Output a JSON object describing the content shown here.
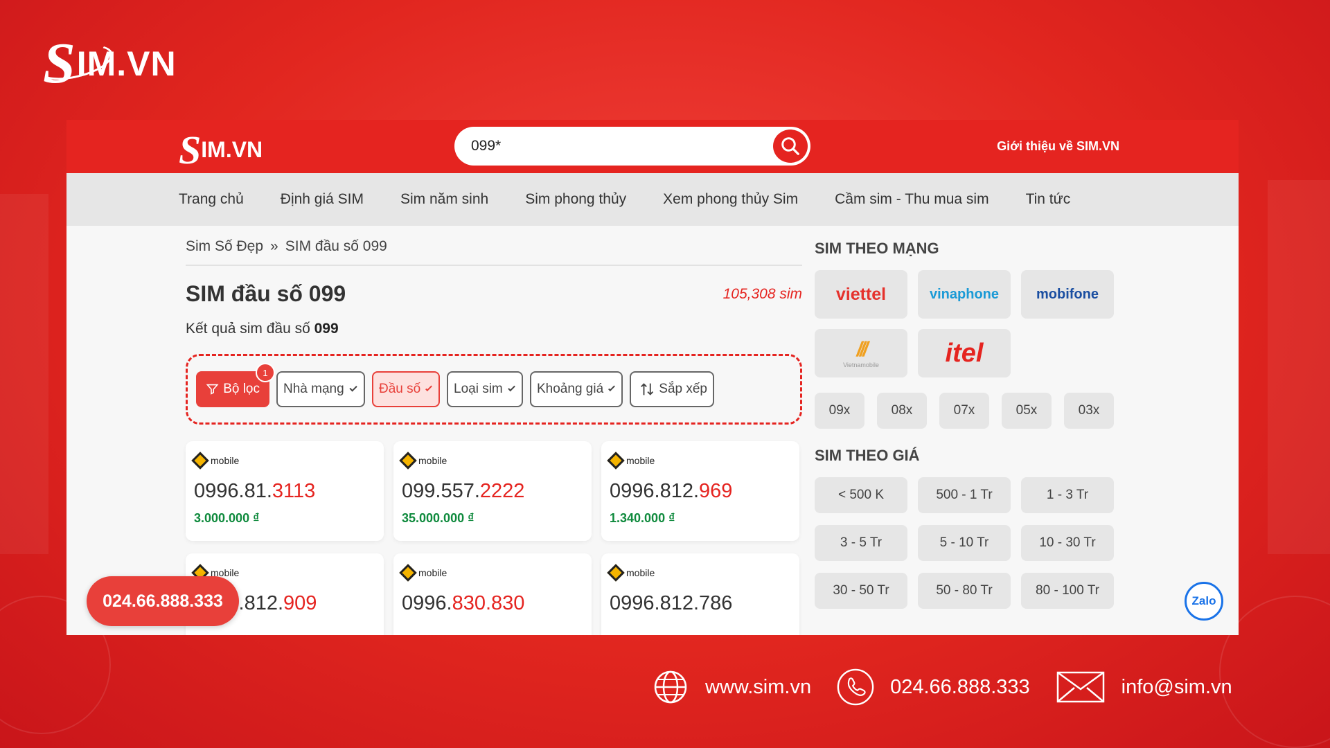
{
  "brand": {
    "logo_s": "S",
    "logo_rest": "IM.VN"
  },
  "header": {
    "search_value": "099*",
    "intro_link": "Giới thiệu về SIM.VN"
  },
  "nav": [
    "Trang chủ",
    "Định giá SIM",
    "Sim năm sinh",
    "Sim phong thủy",
    "Xem phong thủy Sim",
    "Cầm sim - Thu mua sim",
    "Tin tức"
  ],
  "breadcrumb": {
    "home": "Sim Số Đẹp",
    "sep": "»",
    "current": "SIM đầu số 099"
  },
  "page": {
    "title": "SIM đầu số 099",
    "count": "105,308 sim",
    "result_prefix": "Kết quả sim đầu số ",
    "result_bold": "099"
  },
  "filters": {
    "filter_label": "Bộ lọc",
    "badge": "1",
    "network": "Nhà mạng",
    "prefix": "Đầu số",
    "type": "Loại sim",
    "price_range": "Khoảng giá",
    "sort": "Sắp xếp"
  },
  "cards": [
    {
      "brand": "mobile",
      "prefix": "0996.81.",
      "highlight": "3113",
      "price": "3.000.000 ₫"
    },
    {
      "brand": "mobile",
      "prefix": "099.557.",
      "highlight": "2222",
      "price": "35.000.000 ₫"
    },
    {
      "brand": "mobile",
      "prefix": "0996.812.",
      "highlight": "969",
      "price": "1.340.000 ₫"
    },
    {
      "brand": "mobile",
      "prefix": "0996.812.",
      "highlight": "909",
      "price": ""
    },
    {
      "brand": "mobile",
      "prefix": "0996.",
      "highlight": "830.830",
      "price": ""
    },
    {
      "brand": "mobile",
      "prefix": "0996.812.786",
      "highlight": "",
      "price": ""
    }
  ],
  "sidebar": {
    "network_title": "SIM THEO MẠNG",
    "operators": [
      {
        "name": "viettel",
        "color": "#e5322d"
      },
      {
        "name": "vinaphone",
        "color": "#1a9ad6"
      },
      {
        "name": "mobifone",
        "color": "#1a4ea1"
      },
      {
        "name": "Vietnamobile",
        "color": "#f0a020"
      },
      {
        "name": "itel",
        "color": "#e52420"
      }
    ],
    "prefixes": [
      "09x",
      "08x",
      "07x",
      "05x",
      "03x"
    ],
    "price_title": "SIM THEO GIÁ",
    "prices": [
      "< 500 K",
      "500 - 1 Tr",
      "1 - 3 Tr",
      "3 - 5 Tr",
      "5 - 10 Tr",
      "10 - 30 Tr",
      "30 - 50 Tr",
      "50 - 80 Tr",
      "80 - 100 Tr"
    ]
  },
  "hotline": "024.66.888.333",
  "zalo": "Zalo",
  "footer": {
    "website": "www.sim.vn",
    "phone": "024.66.888.333",
    "email": "info@sim.vn"
  },
  "colors": {
    "brand_red": "#e52420",
    "price_green": "#0f8a3d"
  }
}
